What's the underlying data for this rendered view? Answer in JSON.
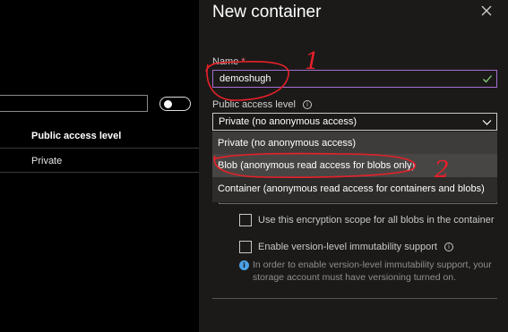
{
  "left": {
    "column_header": "Public access level",
    "row_value": "Private"
  },
  "panel": {
    "title": "New container",
    "name_label": "Name",
    "required_mark": "*",
    "name_value": "demoshugh",
    "access_label": "Public access level",
    "access_selected": "Private (no anonymous access)",
    "options": [
      "Private (no anonymous access)",
      "Blob (anonymous read access for blobs only)",
      "Container (anonymous read access for containers and blobs)"
    ],
    "encryption_scope_label": "Use this encryption scope for all blobs in the container",
    "immutability_label": "Enable version-level immutability support",
    "immutability_note": "In order to enable version-level immutability support, your storage account must have versioning turned on."
  },
  "annotations": {
    "mark_1": "1",
    "mark_2": "2"
  },
  "colors": {
    "annotation_red": "#e8202a",
    "focus_border": "#a66fd1",
    "success_green": "#8ad07a",
    "info_blue": "#4aa0e6"
  }
}
